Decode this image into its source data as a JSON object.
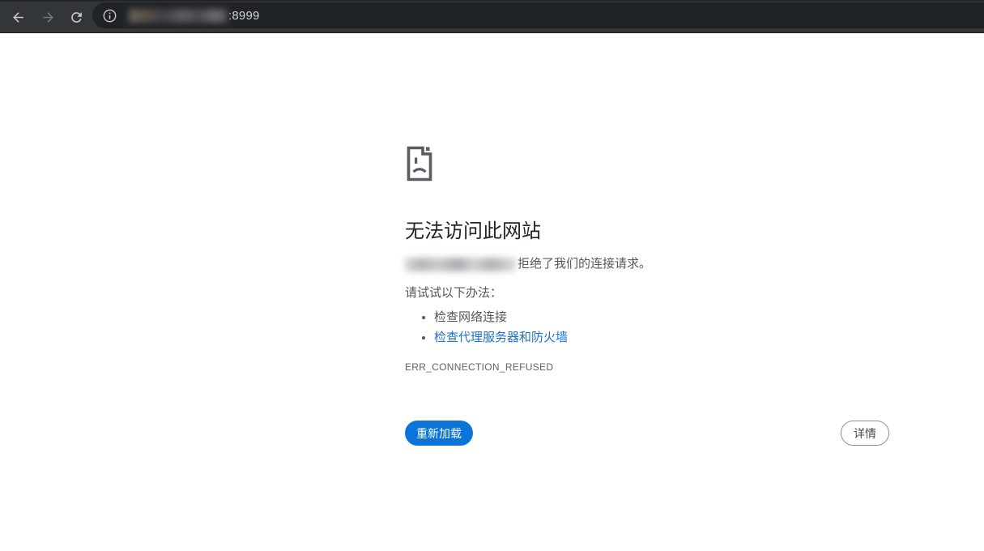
{
  "toolbar": {
    "back_icon": "arrow-left",
    "forward_icon": "arrow-right",
    "reload_icon": "reload",
    "address_bar": {
      "info_icon": "info-circle",
      "url_censored": true,
      "port_text": ":8999"
    }
  },
  "page": {
    "icon": "sad-file",
    "title": "无法访问此网站",
    "message": {
      "host_censored": true,
      "text_after_host": "拒绝了我们的连接请求。"
    },
    "suggestions_heading": "请试试以下办法：",
    "suggestions": [
      {
        "label": "检查网络连接",
        "is_link": false
      },
      {
        "label": "检查代理服务器和防火墙",
        "is_link": true
      }
    ],
    "error_code": "ERR_CONNECTION_REFUSED",
    "buttons": {
      "reload": "重新加载",
      "details": "详情"
    }
  },
  "colors": {
    "toolbar_bg": "#333639",
    "omnibox_bg": "#202326",
    "accent_blue": "#0b74d8",
    "link_blue": "#1d70d2",
    "title_text": "#1f2328",
    "body_text": "#54585c",
    "error_code_text": "#5f6368",
    "page_bg": "#ffffff"
  }
}
